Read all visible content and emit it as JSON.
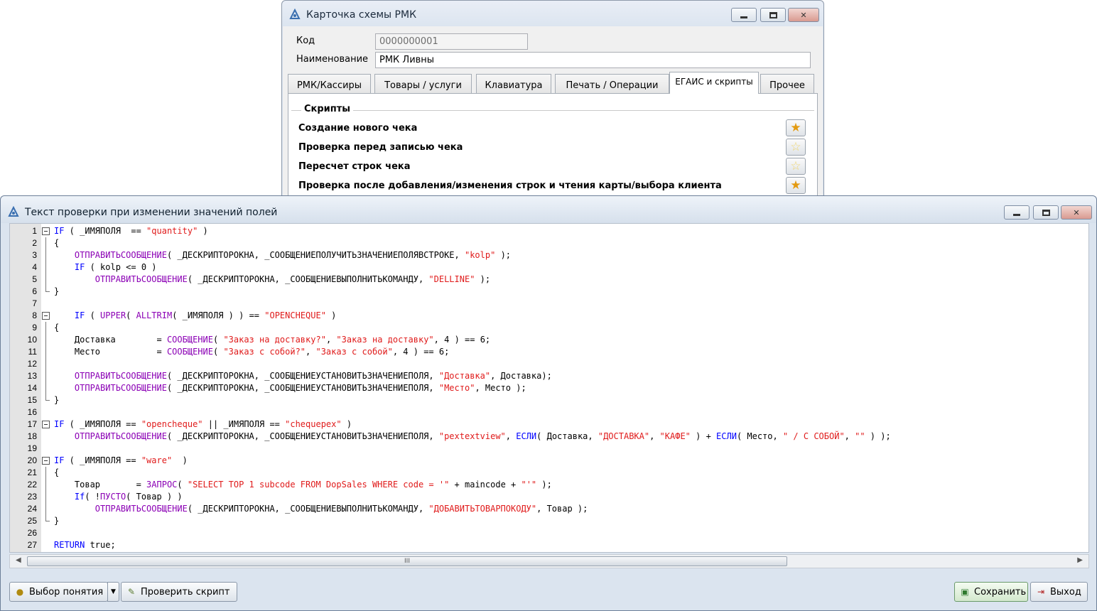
{
  "back_window": {
    "title": "Карточка схемы РМК",
    "code_label": "Код",
    "code_value": "0000000001",
    "name_label": "Наименование",
    "name_value": "РМК Ливны",
    "tabs": [
      "РМК/Кассиры",
      "Товары / услуги",
      "Клавиатура",
      "Печать / Операции",
      "ЕГАИС и скрипты",
      "Прочее"
    ],
    "active_tab": "ЕГАИС и скрипты",
    "group_title": "Скрипты",
    "scripts": [
      {
        "label": "Создание нового чека",
        "star": "filled"
      },
      {
        "label": "Проверка перед записью чека",
        "star": "empty"
      },
      {
        "label": "Пересчет строк чека",
        "star": "empty"
      },
      {
        "label": "Проверка после добавления/изменения строк и чтения карты/выбора клиента",
        "star": "filled"
      }
    ]
  },
  "editor_window": {
    "title": "Текст проверки при изменении значений полей",
    "colors": {
      "keyword": "#0000ff",
      "function": "#8b00b5",
      "string": "#e01b1b",
      "text": "#000000"
    },
    "lines": [
      [
        [
          "kw",
          "IF"
        ],
        [
          "id",
          " ( _ИМЯПОЛЯ  == "
        ],
        [
          "str",
          "\"quantity\""
        ],
        [
          "id",
          " )"
        ]
      ],
      [
        [
          "id",
          "{"
        ]
      ],
      [
        [
          "id",
          "    "
        ],
        [
          "fn",
          "ОТПРАВИТЬСООБЩЕНИЕ"
        ],
        [
          "id",
          "( _ДЕСКРИПТОРОКНА, _СООБЩЕНИЕПОЛУЧИТЬЗНАЧЕНИЕПОЛЯВСТРОКЕ, "
        ],
        [
          "str",
          "\"kolp\""
        ],
        [
          "id",
          " );"
        ]
      ],
      [
        [
          "id",
          "    "
        ],
        [
          "kw",
          "IF"
        ],
        [
          "id",
          " ( kolp <= 0 )"
        ]
      ],
      [
        [
          "id",
          "        "
        ],
        [
          "fn",
          "ОТПРАВИТЬСООБЩЕНИЕ"
        ],
        [
          "id",
          "( _ДЕСКРИПТОРОКНА, _СООБЩЕНИЕВЫПОЛНИТЬКОМАНДУ, "
        ],
        [
          "str",
          "\"DELLINE\""
        ],
        [
          "id",
          " );"
        ]
      ],
      [
        [
          "id",
          "}"
        ]
      ],
      [
        [
          "id",
          ""
        ]
      ],
      [
        [
          "id",
          "    "
        ],
        [
          "kw",
          "IF"
        ],
        [
          "id",
          " ( "
        ],
        [
          "fn",
          "UPPER"
        ],
        [
          "id",
          "( "
        ],
        [
          "fn",
          "ALLTRIM"
        ],
        [
          "id",
          "( _ИМЯПОЛЯ ) ) == "
        ],
        [
          "str",
          "\"OPENCHEQUE\""
        ],
        [
          "id",
          " )"
        ]
      ],
      [
        [
          "id",
          "{"
        ]
      ],
      [
        [
          "id",
          "    Доставка        = "
        ],
        [
          "fn",
          "СООБЩЕНИЕ"
        ],
        [
          "id",
          "( "
        ],
        [
          "str",
          "\"Заказ на доставку?\""
        ],
        [
          "id",
          ", "
        ],
        [
          "str",
          "\"Заказ на доставку\""
        ],
        [
          "id",
          ", 4 ) == 6;"
        ]
      ],
      [
        [
          "id",
          "    Место           = "
        ],
        [
          "fn",
          "СООБЩЕНИЕ"
        ],
        [
          "id",
          "( "
        ],
        [
          "str",
          "\"Заказ с собой?\""
        ],
        [
          "id",
          ", "
        ],
        [
          "str",
          "\"Заказ с собой\""
        ],
        [
          "id",
          ", 4 ) == 6;"
        ]
      ],
      [
        [
          "id",
          ""
        ]
      ],
      [
        [
          "id",
          "    "
        ],
        [
          "fn",
          "ОТПРАВИТЬСООБЩЕНИЕ"
        ],
        [
          "id",
          "( _ДЕСКРИПТОРОКНА, _СООБЩЕНИЕУСТАНОВИТЬЗНАЧЕНИЕПОЛЯ, "
        ],
        [
          "str",
          "\"Доставка\""
        ],
        [
          "id",
          ", Доставка);"
        ]
      ],
      [
        [
          "id",
          "    "
        ],
        [
          "fn",
          "ОТПРАВИТЬСООБЩЕНИЕ"
        ],
        [
          "id",
          "( _ДЕСКРИПТОРОКНА, _СООБЩЕНИЕУСТАНОВИТЬЗНАЧЕНИЕПОЛЯ, "
        ],
        [
          "str",
          "\"Место\""
        ],
        [
          "id",
          ", Место );"
        ]
      ],
      [
        [
          "id",
          "}"
        ]
      ],
      [
        [
          "id",
          ""
        ]
      ],
      [
        [
          "kw",
          "IF"
        ],
        [
          "id",
          " ( _ИМЯПОЛЯ == "
        ],
        [
          "str",
          "\"opencheque\""
        ],
        [
          "id",
          " || _ИМЯПОЛЯ == "
        ],
        [
          "str",
          "\"chequepex\""
        ],
        [
          "id",
          " )"
        ]
      ],
      [
        [
          "id",
          "    "
        ],
        [
          "fn",
          "ОТПРАВИТЬСООБЩЕНИЕ"
        ],
        [
          "id",
          "( _ДЕСКРИПТОРОКНА, _СООБЩЕНИЕУСТАНОВИТЬЗНАЧЕНИЕПОЛЯ, "
        ],
        [
          "str",
          "\"pextextview\""
        ],
        [
          "id",
          ", "
        ],
        [
          "kw",
          "ЕСЛИ"
        ],
        [
          "id",
          "( Доставка, "
        ],
        [
          "str",
          "\"ДОСТАВКА\""
        ],
        [
          "id",
          ", "
        ],
        [
          "str",
          "\"КАФЕ\""
        ],
        [
          "id",
          " ) + "
        ],
        [
          "kw",
          "ЕСЛИ"
        ],
        [
          "id",
          "( Место, "
        ],
        [
          "str",
          "\" / С СОБОЙ\""
        ],
        [
          "id",
          ", "
        ],
        [
          "str",
          "\"\""
        ],
        [
          "id",
          " ) );"
        ]
      ],
      [
        [
          "id",
          ""
        ]
      ],
      [
        [
          "kw",
          "IF"
        ],
        [
          "id",
          " ( _ИМЯПОЛЯ == "
        ],
        [
          "str",
          "\"ware\""
        ],
        [
          "id",
          "  )"
        ]
      ],
      [
        [
          "id",
          "{"
        ]
      ],
      [
        [
          "id",
          "    Товар       = "
        ],
        [
          "fn",
          "ЗАПРОС"
        ],
        [
          "id",
          "( "
        ],
        [
          "str",
          "\"SELECT TOP 1 subcode FROM DopSales WHERE code = '\""
        ],
        [
          "id",
          " + maincode + "
        ],
        [
          "str",
          "\"'\""
        ],
        [
          "id",
          " );"
        ]
      ],
      [
        [
          "id",
          "    "
        ],
        [
          "kw",
          "If"
        ],
        [
          "id",
          "( !"
        ],
        [
          "fn",
          "ПУСТО"
        ],
        [
          "id",
          "( Товар ) )"
        ]
      ],
      [
        [
          "id",
          "        "
        ],
        [
          "fn",
          "ОТПРАВИТЬСООБЩЕНИЕ"
        ],
        [
          "id",
          "( _ДЕСКРИПТОРОКНА, _СООБЩЕНИЕВЫПОЛНИТЬКОМАНДУ, "
        ],
        [
          "str",
          "\"ДОБАВИТЬТОВАРПОКОДУ\""
        ],
        [
          "id",
          ", Товар );"
        ]
      ],
      [
        [
          "id",
          "}"
        ]
      ],
      [
        [
          "id",
          ""
        ]
      ],
      [
        [
          "kw",
          "RETURN"
        ],
        [
          "id",
          " true;"
        ]
      ]
    ],
    "fold_open_lines": [
      1,
      8,
      17,
      20
    ],
    "fold_body_lines": [
      2,
      3,
      4,
      5,
      9,
      10,
      11,
      12,
      13,
      14,
      21,
      22,
      23,
      24
    ],
    "fold_end_lines": [
      6,
      15,
      25
    ],
    "scroll_thumb_glyph": "III",
    "buttons": {
      "choose_concept": "Выбор понятия",
      "check_script": "Проверить скрипт",
      "save": "Сохранить",
      "exit": "Выход"
    }
  }
}
